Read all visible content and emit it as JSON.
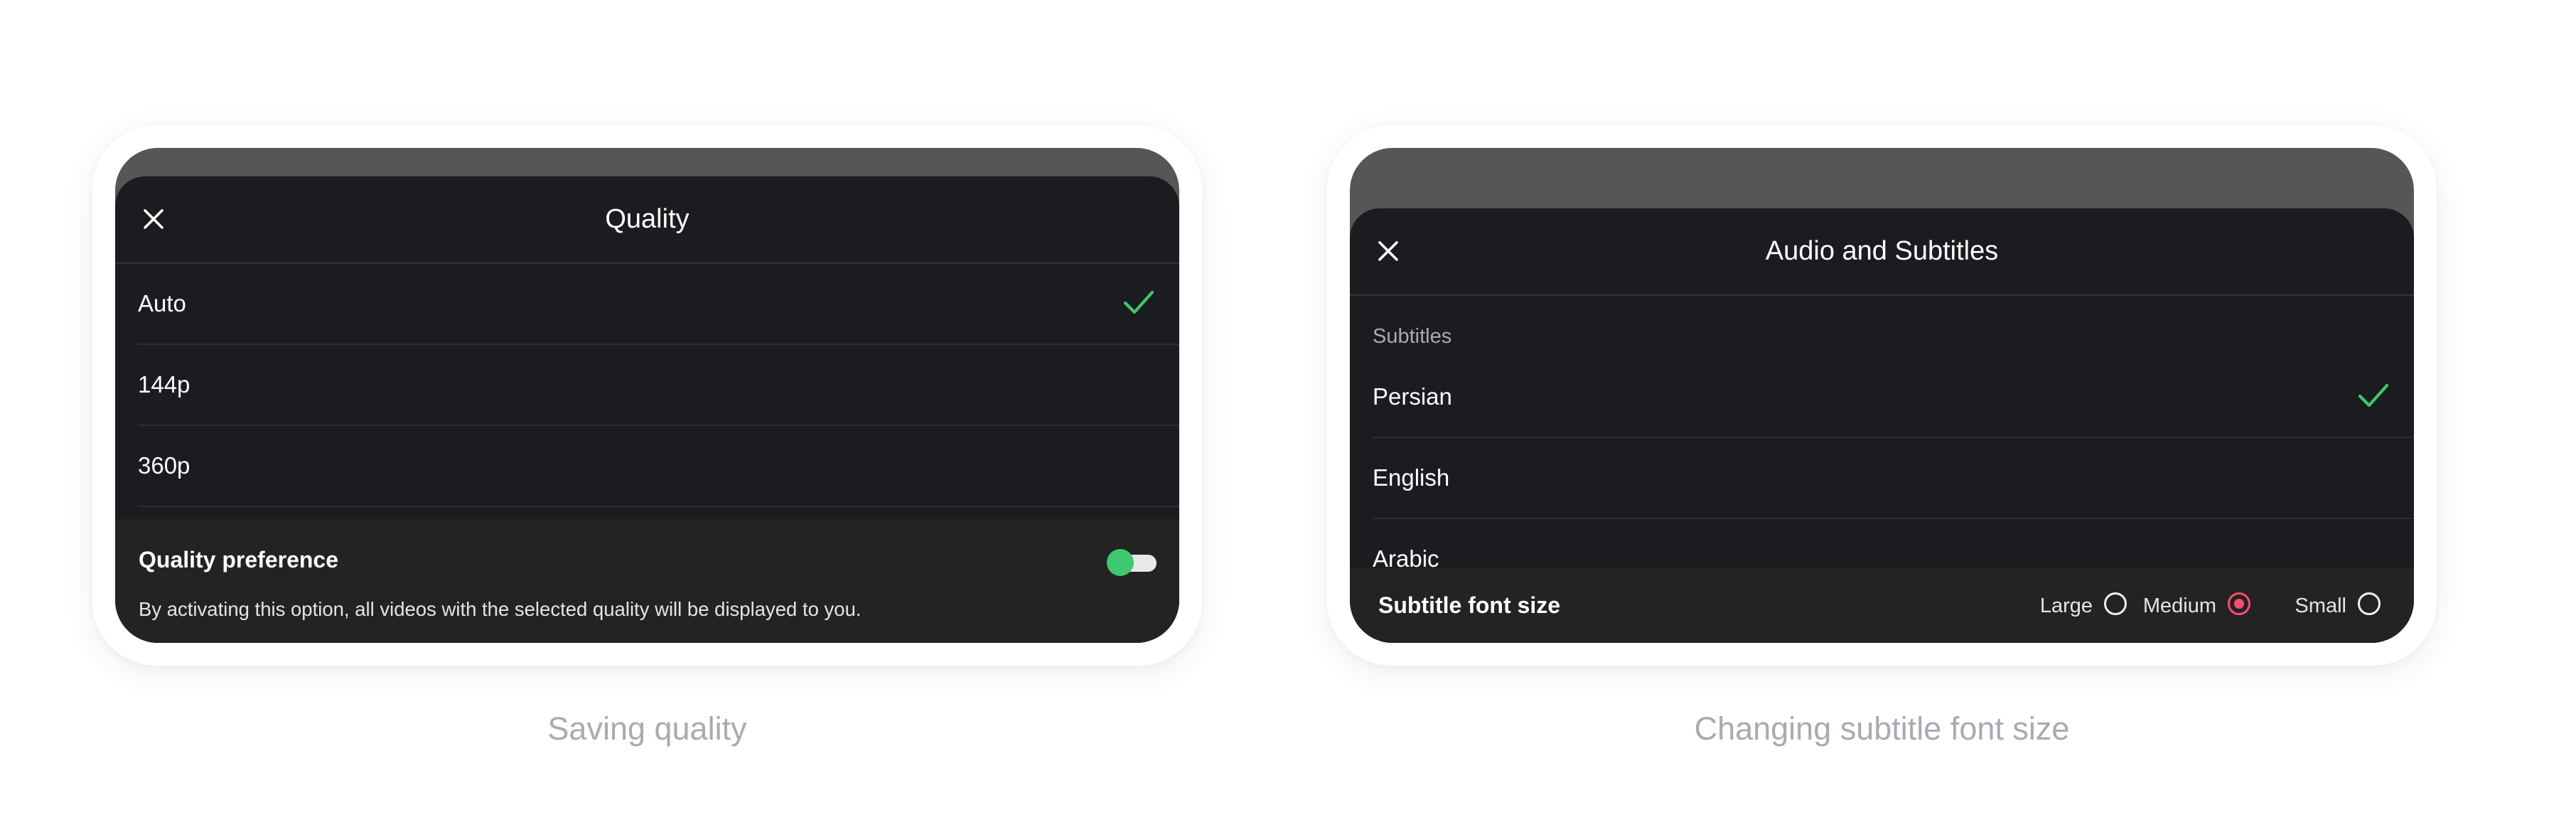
{
  "colors": {
    "accent_green": "#3ec86f",
    "accent_red": "#ff4d6d",
    "sheet_bg": "#1b1c1f",
    "panel_bg": "#232323"
  },
  "quality_sheet": {
    "title": "Quality",
    "close_icon": "close-icon",
    "options": [
      {
        "label": "Auto",
        "selected": true
      },
      {
        "label": "144p",
        "selected": false
      },
      {
        "label": "360p",
        "selected": false
      }
    ],
    "check_icon": "checkmark-icon",
    "preference": {
      "title": "Quality preference",
      "description": "By activating this option, all videos with the selected quality will be displayed to you.",
      "enabled": true
    },
    "caption": "Saving quality"
  },
  "audio_sheet": {
    "title": "Audio and Subtitles",
    "close_icon": "close-icon",
    "section_label": "Subtitles",
    "options": [
      {
        "label": "Persian",
        "selected": true
      },
      {
        "label": "English",
        "selected": false
      },
      {
        "label": "Arabic",
        "selected": false
      }
    ],
    "check_icon": "checkmark-icon",
    "font_size": {
      "title": "Subtitle font size",
      "options": [
        {
          "label": "Large",
          "selected": false
        },
        {
          "label": "Medium",
          "selected": true
        },
        {
          "label": "Small",
          "selected": false
        }
      ]
    },
    "caption": "Changing subtitle font size"
  }
}
